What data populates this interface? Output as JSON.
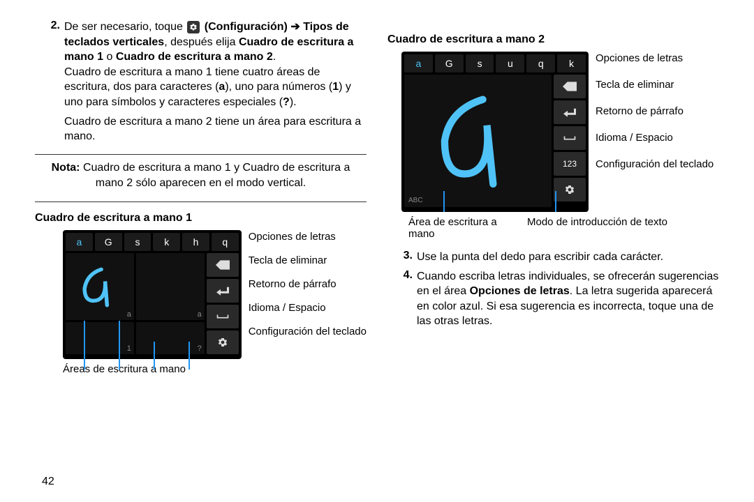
{
  "left": {
    "step2_num": "2.",
    "step2_part1": "De ser necesario, toque ",
    "step2_conf": "(Configuración) ➔",
    "step2_tipos": "Tipos de teclados verticales",
    "step2_despues": ", después elija ",
    "step2_c1": "Cuadro de escritura a mano 1",
    "step2_or": " o ",
    "step2_c2": "Cuadro de escritura a mano 2",
    "step2_end": ".",
    "para1": "Cuadro de escritura a mano 1 tiene cuatro áreas de escritura, dos para caracteres (",
    "para1_a": "a",
    "para1_b": "), uno para números (",
    "para1_1": "1",
    "para1_c": ") y uno para símbolos y caracteres especiales (",
    "para1_q": "?",
    "para1_d": ").",
    "para2": "Cuadro de escritura a mano 2 tiene un área para escritura a mano.",
    "note_lead": "Nota:",
    "note_rest": " Cuadro de escritura a mano 1 y Cuadro de escritura a mano 2 sólo aparecen en el modo vertical.",
    "section1": "Cuadro de escritura a mano 1",
    "letters1": [
      "a",
      "G",
      "s",
      "k",
      "h",
      "q"
    ],
    "kb_labels": [
      "Opciones de letras",
      "Tecla de eliminar",
      "Retorno de párrafo",
      "Idioma / Espacio",
      "Configuración del teclado"
    ],
    "below1": "Áreas de escritura a mano",
    "hw_sub_a": "a",
    "hw_sub_1": "1",
    "hw_sub_q": "?"
  },
  "right": {
    "section2": "Cuadro de escritura a mano 2",
    "letters2": [
      "a",
      "G",
      "s",
      "u",
      "q",
      "k"
    ],
    "kb_labels": [
      "Opciones de letras",
      "Tecla de eliminar",
      "Retorno de párrafo",
      "Idioma / Espacio",
      "Configuración del teclado"
    ],
    "below2a": "Área de escritura a mano",
    "below2b": "Modo de introducción de texto",
    "num123": "123",
    "abc": "ABC",
    "step3_num": "3.",
    "step3_text": "Use la punta del dedo para escribir cada carácter.",
    "step4_num": "4.",
    "step4_a": "Cuando escriba letras individuales, se ofrecerán sugerencias en el área ",
    "step4_bold": "Opciones de letras",
    "step4_b": ". La letra sugerida aparecerá en color azul. Si esa sugerencia es incorrecta, toque una de las otras letras."
  },
  "pagenum": "42"
}
